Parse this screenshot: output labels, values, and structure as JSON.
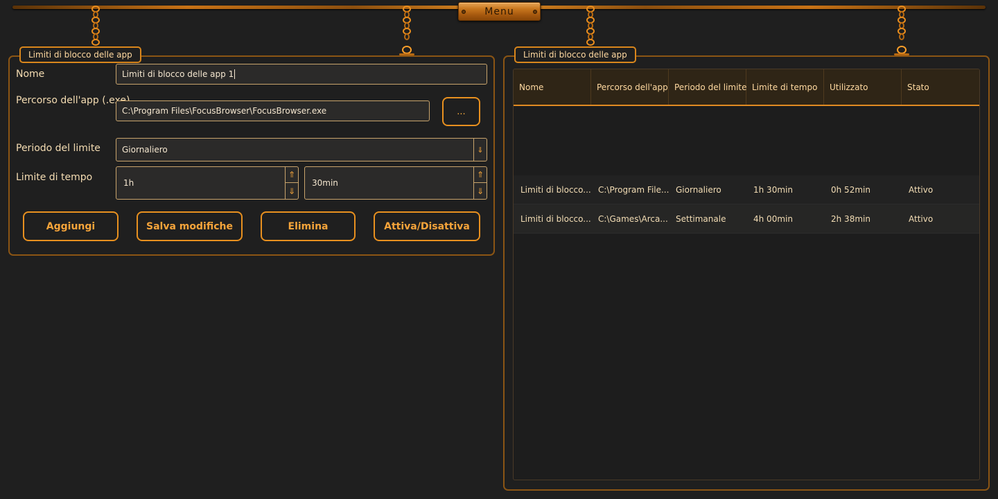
{
  "menu": {
    "label": "Menu"
  },
  "left_panel": {
    "title": "Limiti di blocco delle app",
    "name_label": "Nome",
    "name_value": "Limiti di blocco delle app 1",
    "path_label": "Percorso dell'app (.exe)",
    "path_value": "C:\\Program Files\\FocusBrowser\\FocusBrowser.exe",
    "browse_label": "...",
    "period_label": "Periodo del limite",
    "period_value": "Giornaliero",
    "time_label": "Limite di tempo",
    "hours_value": "1h",
    "minutes_value": "30min",
    "buttons": {
      "add": "Aggiungi",
      "save": "Salva modifiche",
      "delete": "Elimina",
      "toggle": "Attiva/Disattiva"
    }
  },
  "right_panel": {
    "title": "Limiti di blocco delle app",
    "columns": [
      "Nome",
      "Percorso dell'app",
      "Periodo del limite",
      "Limite di tempo",
      "Utilizzato",
      "Stato"
    ],
    "rows": [
      [
        "Limiti di blocco...",
        "C:\\Program File...",
        "Giornaliero",
        "1h 30min",
        "0h 52min",
        "Attivo"
      ],
      [
        "Limiti di blocco...",
        "C:\\Games\\Arca...",
        "Settimanale",
        "4h 00min",
        "2h 38min",
        "Attivo"
      ]
    ]
  },
  "colors": {
    "accent": "#e8901f",
    "background": "#1f1f1f",
    "text": "#f2dcb4"
  }
}
